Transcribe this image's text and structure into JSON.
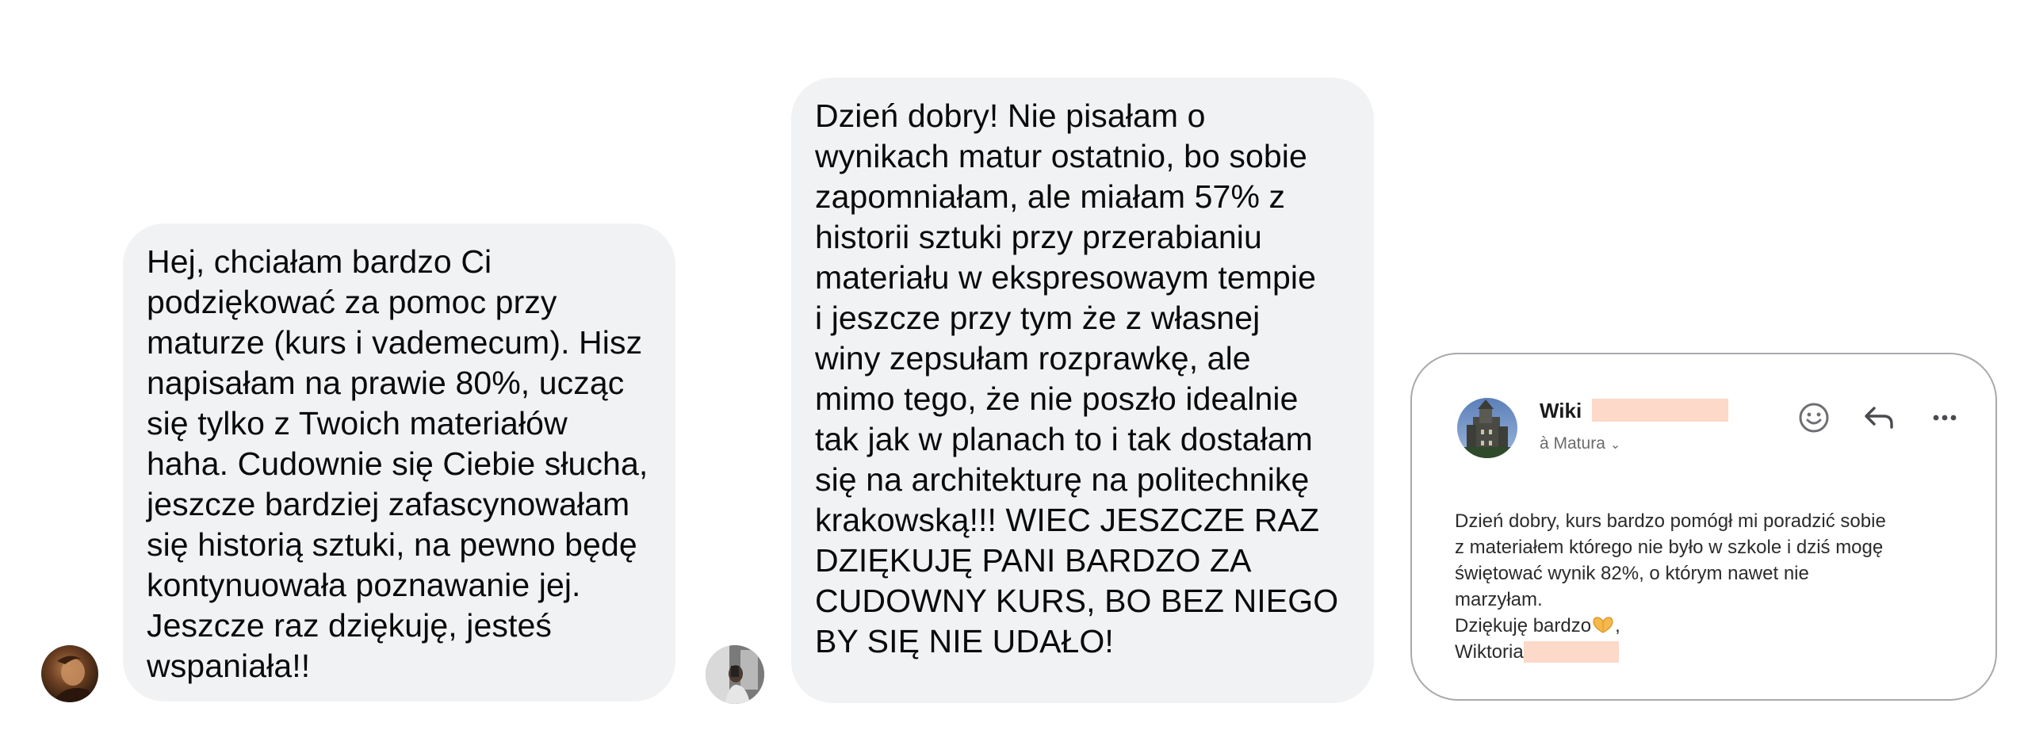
{
  "messages": [
    {
      "lines": [
        "Hej, chciałam bardzo Ci",
        "podziękować za pomoc przy",
        "maturze (kurs i vademecum). Hisz",
        "napisałam na prawie 80%, ucząc",
        "się tylko z Twoich materiałów",
        "haha. Cudownie się Ciebie słucha,",
        "jeszcze bardziej zafascynowałam",
        "się historią sztuki, na pewno będę",
        "kontynuowała poznawanie jej.",
        "Jeszcze raz dziękuję, jesteś",
        "wspaniała!!"
      ]
    },
    {
      "lines": [
        "Dzień dobry! Nie pisałam o",
        "wynikach matur ostatnio, bo sobie",
        "zapomniałam, ale miałam 57% z",
        "historii sztuki przy przerabianiu",
        "materiału w ekspresowaym tempie",
        "i jeszcze przy tym że z własnej",
        "winy zepsułam rozprawkę, ale",
        "mimo tego, że nie poszło idealnie",
        "tak jak w planach to i tak dostałam",
        "się na architekturę na politechnikę",
        "krakowską!!! WIEC JESZCZE RAZ",
        "DZIĘKUJĘ PANI BARDZO ZA",
        "CUDOWNY KURS, BO BEZ NIEGO",
        "BY SIĘ NIE UDAŁO!"
      ]
    }
  ],
  "email": {
    "sender": "Wiki",
    "folder": "à Matura",
    "icons": [
      "smiley-icon",
      "reply-icon",
      "more-icon",
      "chevron-down-icon",
      "heart-hands-emoji"
    ],
    "body_lines": [
      "Dzień dobry, kurs bardzo pomógł mi poradzić sobie",
      "z materiałem którego nie było w szkole i dziś mogę",
      "świętować wynik 82%,  o którym nawet nie",
      "marzyłam."
    ],
    "thanks": "Dziękuję bardzo",
    "thanks_suffix": ",",
    "signature": "Wiktoria"
  },
  "colors": {
    "bubble_background": "#f1f2f4",
    "email_border": "#a9a9ad",
    "redaction": "#fcd9c8",
    "secondary_text": "#6b6b6b"
  }
}
